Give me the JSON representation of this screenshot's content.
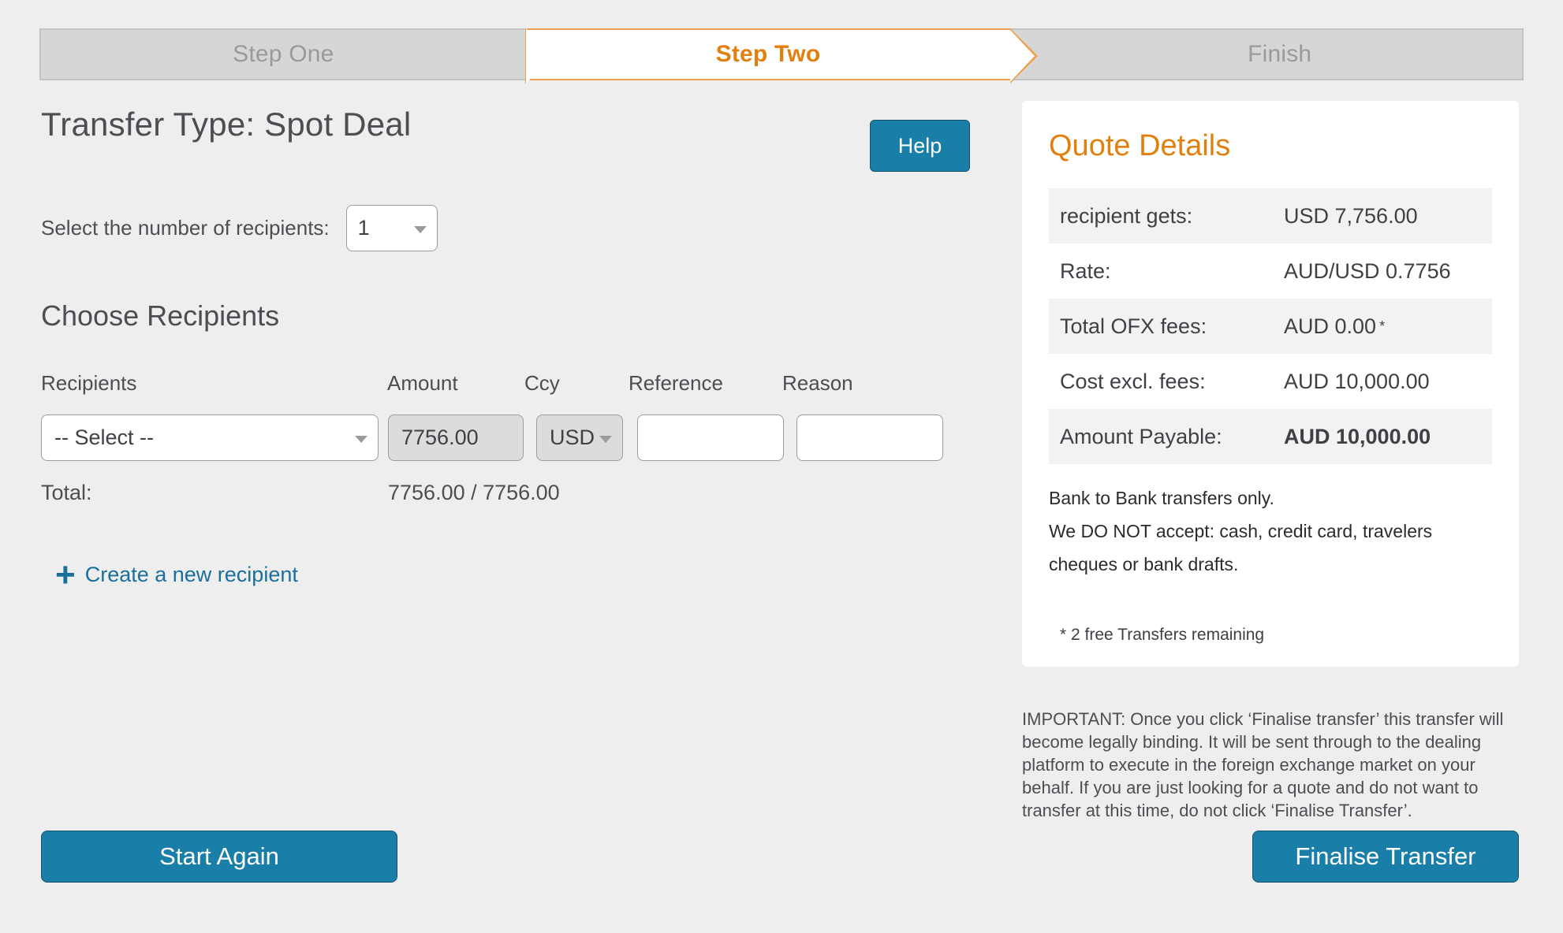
{
  "steps": [
    {
      "label": "Step One",
      "state": "inactive"
    },
    {
      "label": "Step Two",
      "state": "active"
    },
    {
      "label": "Finish",
      "state": "inactive"
    }
  ],
  "header": {
    "title": "Transfer Type: Spot Deal",
    "help_label": "Help"
  },
  "recipient_count": {
    "label": "Select the number of recipients:",
    "value": "1"
  },
  "choose_recipients": {
    "section_title": "Choose Recipients",
    "columns": {
      "recipients": "Recipients",
      "amount": "Amount",
      "ccy": "Ccy",
      "reference": "Reference",
      "reason": "Reason"
    },
    "row": {
      "recipient_value": "-- Select --",
      "amount_value": "7756.00",
      "ccy_value": "USD",
      "reference_value": "",
      "reason_value": "",
      "reference_placeholder": "",
      "reason_placeholder": ""
    },
    "total_label": "Total:",
    "total_value": "7756.00 / 7756.00",
    "create_recipient_label": "Create a new recipient",
    "plus_glyph": "+"
  },
  "quote": {
    "title": "Quote Details",
    "rows": [
      {
        "label": "recipient gets:",
        "value": "USD 7,756.00",
        "shaded": true,
        "bold": false,
        "sup": ""
      },
      {
        "label": "Rate:",
        "value": "AUD/USD 0.7756",
        "shaded": false,
        "bold": false,
        "sup": ""
      },
      {
        "label": "Total OFX fees:",
        "value": "AUD 0.00",
        "shaded": true,
        "bold": false,
        "sup": "*"
      },
      {
        "label": "Cost excl. fees:",
        "value": "AUD 10,000.00",
        "shaded": false,
        "bold": false,
        "sup": ""
      },
      {
        "label": "Amount Payable:",
        "value": "AUD 10,000.00",
        "shaded": true,
        "bold": true,
        "sup": ""
      }
    ],
    "note_line_1": "Bank to Bank transfers only.",
    "note_line_2": "We DO NOT accept: cash, credit card, travelers cheques or bank drafts.",
    "footnote": "* 2 free Transfers remaining"
  },
  "important_notice": "IMPORTANT: Once you click ‘Finalise transfer’ this transfer will become legally binding. It will be sent through to the dealing platform to execute in the foreign exchange market on your behalf. If you are just looking for a quote and do not want to transfer at this time, do not click ‘Finalise Transfer’.",
  "footer": {
    "start_again_label": "Start Again",
    "finalise_label": "Finalise Transfer"
  },
  "colors": {
    "page_bg": "#eeeeee",
    "accent_orange": "#e2800f",
    "step_border_orange": "#f0a04a",
    "button_blue": "#1a7fa8",
    "link_blue": "#1b6f9c",
    "text_dark": "#4d4d53",
    "step_inactive_bg": "#d6d6d6",
    "step_inactive_text": "#9a9a9e",
    "disabled_field_bg": "#dcdcdc",
    "quote_row_shade": "#f2f2f2"
  }
}
